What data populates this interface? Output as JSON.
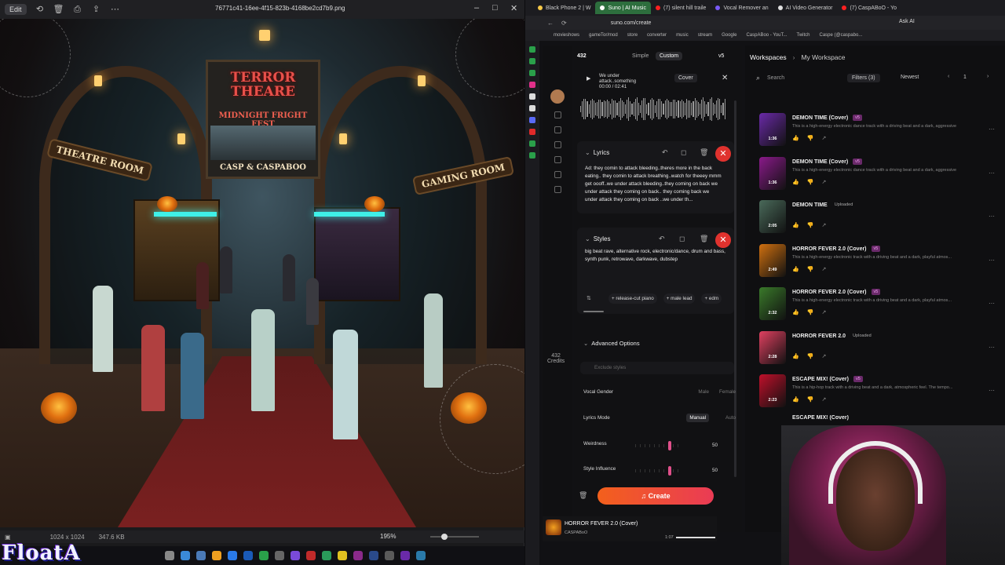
{
  "viewer": {
    "edit_label": "Edit",
    "filename": "76771c41-16ee-4f15-823b-4168be2cd7b9.png",
    "image_size": "1024 x 1024",
    "file_size": "347.6 KB",
    "zoom": "195%",
    "poster": {
      "title": "TERROR THEARE",
      "subtitle": "MIDNIGHT FRIGHT FEST",
      "credit": "CASP & CASPABOO"
    },
    "left_room_sign": "THEATRE ROOM",
    "right_room_sign": "GAMING ROOM",
    "overlay_logo": "FloatA"
  },
  "browser": {
    "tabs": [
      {
        "label": "Black Phone 2 | W",
        "color": "#f7c948"
      },
      {
        "label": "Suno | AI Music",
        "color": "#ffffff",
        "active": true
      },
      {
        "label": "(7) silent hill traile",
        "color": "#ff2020"
      },
      {
        "label": "Vocal Remover an",
        "color": "#7a5af8"
      },
      {
        "label": "AI Video Generator",
        "color": "#e0e0e0"
      },
      {
        "label": "(7) CaspABoO - Yo",
        "color": "#ff2020"
      }
    ],
    "url": "suno.com/create",
    "ask_ai": "Ask AI",
    "bookmarks": [
      "movieshows",
      "gameTor/mod",
      "store",
      "converter",
      "music",
      "stream",
      "Google",
      "CaspABoo - YouT...",
      "Twitch",
      "Caspe (@caspabo..."
    ]
  },
  "suno": {
    "credits": "432",
    "mode_simple": "Simple",
    "mode_custom": "Custom",
    "version": "v5",
    "cover_title": "We under attack..something",
    "cover_time": "00:00 / 02:41",
    "cover_mode": "Cover",
    "lyrics_label": "Lyrics",
    "lyrics_text": "Ad: they comin to attack bleeding..theres more in the back eating.. they comin to attack breathing..watch for theeey mmm get oooff..we under attack bleeding..they coming on back we under attack they coming on back.. they coming back we under attack they coming on back ..we under th...",
    "styles_label": "Styles",
    "styles_text": "big beat rave, alternative rock, electronic/dance, drum and bass, synth punk, retrowave, darkwave, dubstep",
    "chips": [
      "+ release-cut piano",
      "+ male lead",
      "+ edm"
    ],
    "advanced_label": "Advanced Options",
    "exclude_placeholder": "Exclude styles",
    "vocal_gender": {
      "label": "Vocal Gender",
      "a": "Male",
      "b": "Female"
    },
    "lyrics_mode": {
      "label": "Lyrics Mode",
      "a": "Manual",
      "b": "Auto"
    },
    "weirdness": {
      "label": "Weirdness",
      "value": "50"
    },
    "style_influence": {
      "label": "Style Influence",
      "value": "50"
    },
    "credits_side": "432",
    "credits_side_label": "Credits",
    "create_label": "Create",
    "player_title": "HORROR FEVER 2.0 (Cover)",
    "player_artist": "CASPABoO",
    "player_time": "1:07"
  },
  "workspace": {
    "title": "Workspaces",
    "current": "My Workspace",
    "search_placeholder": "Search",
    "filters": "Filters (3)",
    "sort": "Newest",
    "page": "1",
    "songs": [
      {
        "title": "DEMON TIME (Cover)",
        "badge": "v5",
        "badge_type": "v",
        "desc": "This is a high-energy electronic dance track with a driving beat and a dark, aggressive at...",
        "dur": "1:36",
        "color": "#6a2aa8"
      },
      {
        "title": "DEMON TIME (Cover)",
        "badge": "v5",
        "badge_type": "v",
        "desc": "This is a high-energy electronic dance track with a driving beat and a dark, aggressive at...",
        "dur": "1:36",
        "color": "#8a1a8a"
      },
      {
        "title": "DEMON TIME",
        "badge": "Uploaded",
        "badge_type": "u",
        "desc": "",
        "dur": "2:05",
        "color": "#4a6a5a"
      },
      {
        "title": "HORROR FEVER 2.0 (Cover)",
        "badge": "v5",
        "badge_type": "v",
        "desc": "This is a high-energy electronic track with a driving beat and a dark, playful atmos...",
        "dur": "2:49",
        "color": "#d07010"
      },
      {
        "title": "HORROR FEVER 2.0 (Cover)",
        "badge": "v5",
        "badge_type": "v",
        "desc": "This is a high-energy electronic track with a driving beat and a dark, playful atmos...",
        "dur": "2:32",
        "color": "#3a7a2a"
      },
      {
        "title": "HORROR FEVER 2.0",
        "badge": "Uploaded",
        "badge_type": "u",
        "desc": "",
        "dur": "2:28",
        "color": "#e04060"
      },
      {
        "title": "ESCAPE MIX! (Cover)",
        "badge": "v5",
        "badge_type": "v",
        "desc": "This is a hip-hop track with a driving beat and a dark, atmospheric feel. The tempo...",
        "dur": "2:23",
        "color": "#c0102a"
      }
    ],
    "partial_title": "ESCAPE MIX! (Cover)"
  }
}
